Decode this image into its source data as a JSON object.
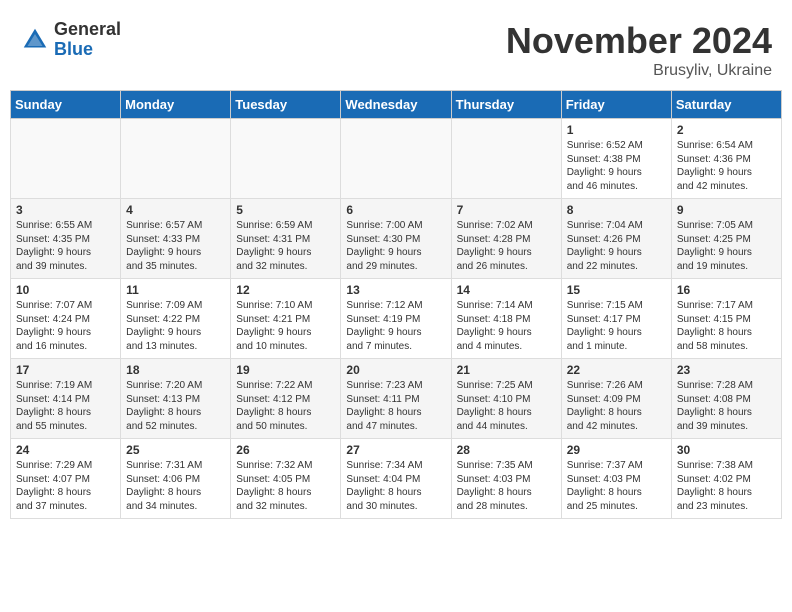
{
  "logo": {
    "general": "General",
    "blue": "Blue"
  },
  "title": "November 2024",
  "location": "Brusyliv, Ukraine",
  "weekdays": [
    "Sunday",
    "Monday",
    "Tuesday",
    "Wednesday",
    "Thursday",
    "Friday",
    "Saturday"
  ],
  "weeks": [
    [
      {
        "day": "",
        "info": ""
      },
      {
        "day": "",
        "info": ""
      },
      {
        "day": "",
        "info": ""
      },
      {
        "day": "",
        "info": ""
      },
      {
        "day": "",
        "info": ""
      },
      {
        "day": "1",
        "info": "Sunrise: 6:52 AM\nSunset: 4:38 PM\nDaylight: 9 hours\nand 46 minutes."
      },
      {
        "day": "2",
        "info": "Sunrise: 6:54 AM\nSunset: 4:36 PM\nDaylight: 9 hours\nand 42 minutes."
      }
    ],
    [
      {
        "day": "3",
        "info": "Sunrise: 6:55 AM\nSunset: 4:35 PM\nDaylight: 9 hours\nand 39 minutes."
      },
      {
        "day": "4",
        "info": "Sunrise: 6:57 AM\nSunset: 4:33 PM\nDaylight: 9 hours\nand 35 minutes."
      },
      {
        "day": "5",
        "info": "Sunrise: 6:59 AM\nSunset: 4:31 PM\nDaylight: 9 hours\nand 32 minutes."
      },
      {
        "day": "6",
        "info": "Sunrise: 7:00 AM\nSunset: 4:30 PM\nDaylight: 9 hours\nand 29 minutes."
      },
      {
        "day": "7",
        "info": "Sunrise: 7:02 AM\nSunset: 4:28 PM\nDaylight: 9 hours\nand 26 minutes."
      },
      {
        "day": "8",
        "info": "Sunrise: 7:04 AM\nSunset: 4:26 PM\nDaylight: 9 hours\nand 22 minutes."
      },
      {
        "day": "9",
        "info": "Sunrise: 7:05 AM\nSunset: 4:25 PM\nDaylight: 9 hours\nand 19 minutes."
      }
    ],
    [
      {
        "day": "10",
        "info": "Sunrise: 7:07 AM\nSunset: 4:24 PM\nDaylight: 9 hours\nand 16 minutes."
      },
      {
        "day": "11",
        "info": "Sunrise: 7:09 AM\nSunset: 4:22 PM\nDaylight: 9 hours\nand 13 minutes."
      },
      {
        "day": "12",
        "info": "Sunrise: 7:10 AM\nSunset: 4:21 PM\nDaylight: 9 hours\nand 10 minutes."
      },
      {
        "day": "13",
        "info": "Sunrise: 7:12 AM\nSunset: 4:19 PM\nDaylight: 9 hours\nand 7 minutes."
      },
      {
        "day": "14",
        "info": "Sunrise: 7:14 AM\nSunset: 4:18 PM\nDaylight: 9 hours\nand 4 minutes."
      },
      {
        "day": "15",
        "info": "Sunrise: 7:15 AM\nSunset: 4:17 PM\nDaylight: 9 hours\nand 1 minute."
      },
      {
        "day": "16",
        "info": "Sunrise: 7:17 AM\nSunset: 4:15 PM\nDaylight: 8 hours\nand 58 minutes."
      }
    ],
    [
      {
        "day": "17",
        "info": "Sunrise: 7:19 AM\nSunset: 4:14 PM\nDaylight: 8 hours\nand 55 minutes."
      },
      {
        "day": "18",
        "info": "Sunrise: 7:20 AM\nSunset: 4:13 PM\nDaylight: 8 hours\nand 52 minutes."
      },
      {
        "day": "19",
        "info": "Sunrise: 7:22 AM\nSunset: 4:12 PM\nDaylight: 8 hours\nand 50 minutes."
      },
      {
        "day": "20",
        "info": "Sunrise: 7:23 AM\nSunset: 4:11 PM\nDaylight: 8 hours\nand 47 minutes."
      },
      {
        "day": "21",
        "info": "Sunrise: 7:25 AM\nSunset: 4:10 PM\nDaylight: 8 hours\nand 44 minutes."
      },
      {
        "day": "22",
        "info": "Sunrise: 7:26 AM\nSunset: 4:09 PM\nDaylight: 8 hours\nand 42 minutes."
      },
      {
        "day": "23",
        "info": "Sunrise: 7:28 AM\nSunset: 4:08 PM\nDaylight: 8 hours\nand 39 minutes."
      }
    ],
    [
      {
        "day": "24",
        "info": "Sunrise: 7:29 AM\nSunset: 4:07 PM\nDaylight: 8 hours\nand 37 minutes."
      },
      {
        "day": "25",
        "info": "Sunrise: 7:31 AM\nSunset: 4:06 PM\nDaylight: 8 hours\nand 34 minutes."
      },
      {
        "day": "26",
        "info": "Sunrise: 7:32 AM\nSunset: 4:05 PM\nDaylight: 8 hours\nand 32 minutes."
      },
      {
        "day": "27",
        "info": "Sunrise: 7:34 AM\nSunset: 4:04 PM\nDaylight: 8 hours\nand 30 minutes."
      },
      {
        "day": "28",
        "info": "Sunrise: 7:35 AM\nSunset: 4:03 PM\nDaylight: 8 hours\nand 28 minutes."
      },
      {
        "day": "29",
        "info": "Sunrise: 7:37 AM\nSunset: 4:03 PM\nDaylight: 8 hours\nand 25 minutes."
      },
      {
        "day": "30",
        "info": "Sunrise: 7:38 AM\nSunset: 4:02 PM\nDaylight: 8 hours\nand 23 minutes."
      }
    ]
  ]
}
